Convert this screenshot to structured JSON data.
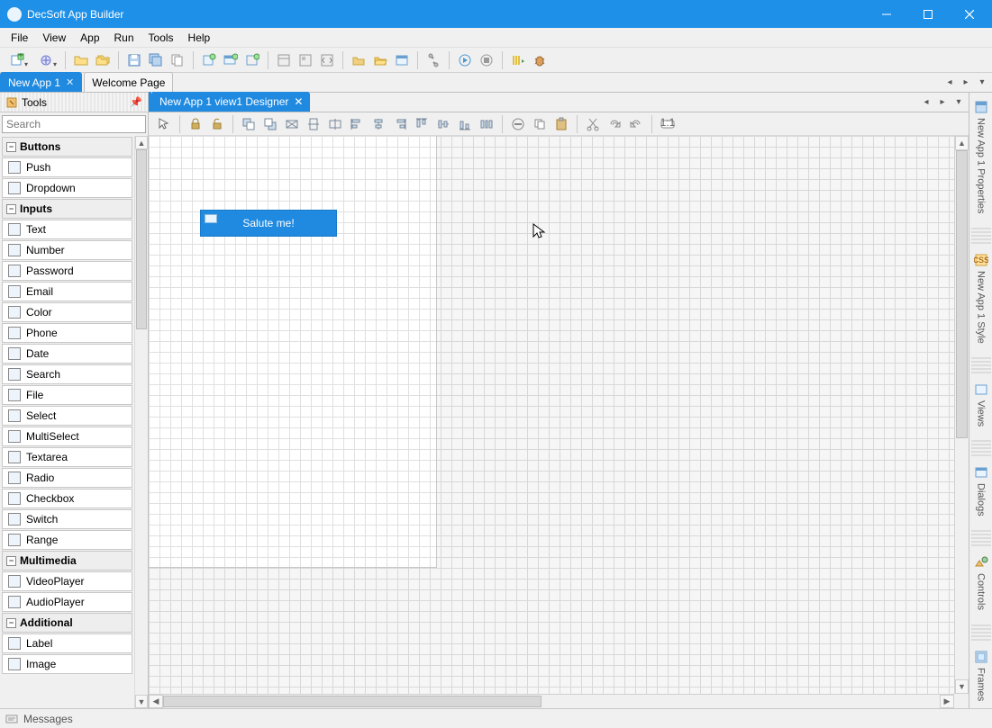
{
  "app": {
    "title": "DecSoft App Builder"
  },
  "menubar": [
    "File",
    "View",
    "App",
    "Run",
    "Tools",
    "Help"
  ],
  "apptabs": [
    {
      "label": "New App 1",
      "active": true
    },
    {
      "label": "Welcome Page",
      "active": false
    }
  ],
  "toolsPanel": {
    "title": "Tools",
    "searchPlaceholder": "Search",
    "groups": [
      {
        "name": "Buttons",
        "items": [
          "Push",
          "Dropdown"
        ]
      },
      {
        "name": "Inputs",
        "items": [
          "Text",
          "Number",
          "Password",
          "Email",
          "Color",
          "Phone",
          "Date",
          "Search",
          "File",
          "Select",
          "MultiSelect",
          "Textarea",
          "Radio",
          "Checkbox",
          "Switch",
          "Range"
        ]
      },
      {
        "name": "Multimedia",
        "items": [
          "VideoPlayer",
          "AudioPlayer"
        ]
      },
      {
        "name": "Additional",
        "items": [
          "Label",
          "Image"
        ]
      }
    ]
  },
  "designer": {
    "tabLabel": "New App 1 view1 Designer",
    "placedButtonLabel": "Salute me!"
  },
  "rightTabs": [
    "New App 1 Properties",
    "New App 1 Style",
    "Views",
    "Dialogs",
    "Controls",
    "Frames"
  ],
  "statusbar": {
    "messages": "Messages"
  }
}
